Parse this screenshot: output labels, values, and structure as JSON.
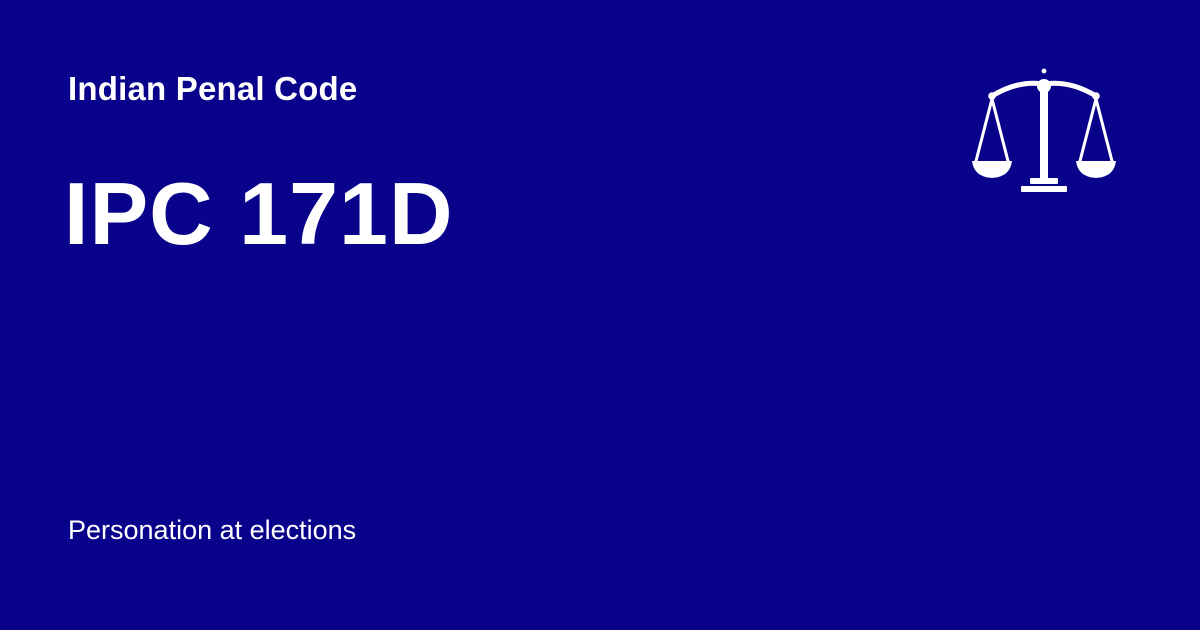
{
  "header": {
    "category": "Indian Penal Code"
  },
  "section": {
    "code": "IPC 171D",
    "title": "Personation at elections"
  },
  "icon": {
    "name": "scales-of-justice-icon"
  },
  "colors": {
    "background": "#08038a",
    "text": "#ffffff"
  }
}
